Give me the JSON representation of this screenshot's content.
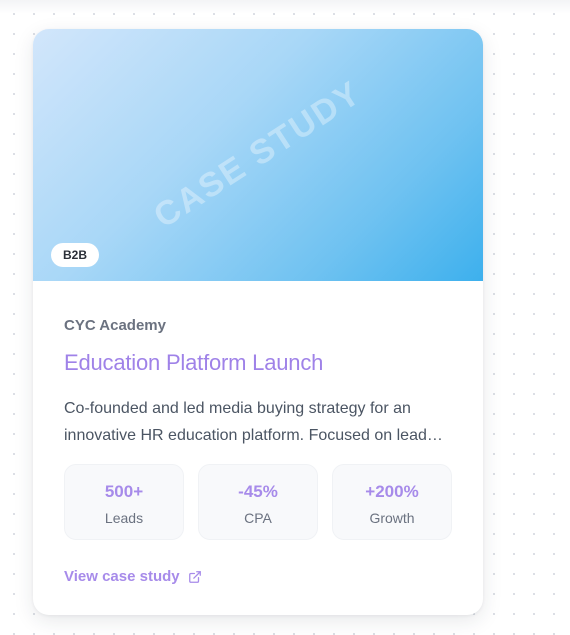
{
  "card": {
    "hero": {
      "watermark": "CASE STUDY",
      "badge": "B2B"
    },
    "client": "CYC Academy",
    "title": "Education Platform Launch",
    "description": "Co-founded and led media buying strategy for an innovative HR education platform. Focused on lead…",
    "stats": [
      {
        "value": "500+",
        "label": "Leads"
      },
      {
        "value": "-45%",
        "label": "CPA"
      },
      {
        "value": "+200%",
        "label": "Growth"
      }
    ],
    "cta": {
      "label": "View case study",
      "icon": "external-link-icon"
    }
  },
  "colors": {
    "accent": "#a78bea",
    "hero_gradient_start": "#d2e6fb",
    "hero_gradient_end": "#3db0ed"
  }
}
